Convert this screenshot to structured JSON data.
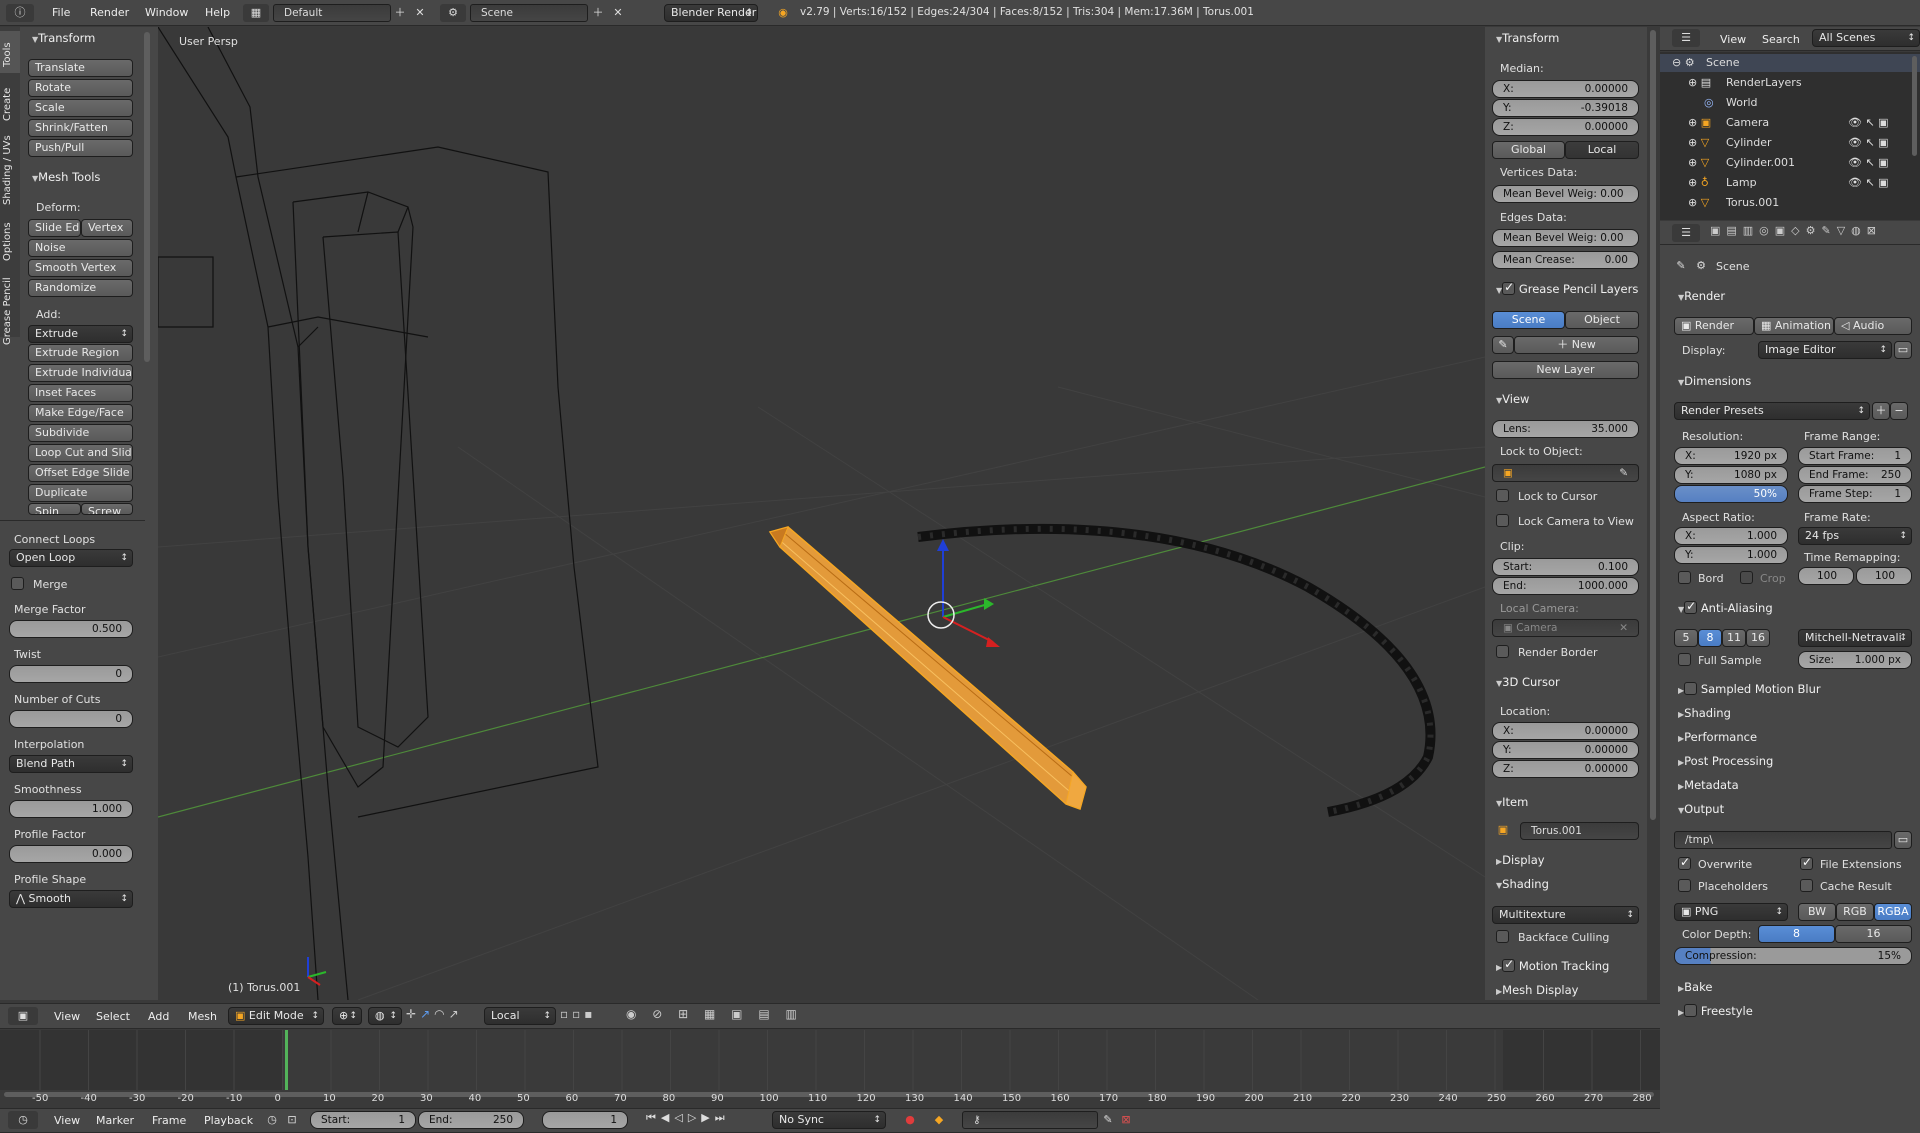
{
  "top_bar": {
    "menus": [
      "File",
      "Render",
      "Window",
      "Help"
    ],
    "screen_layout": "Default",
    "scene": "Scene",
    "engine": "Blender Render",
    "stats": "v2.79 | Verts:16/152 | Edges:24/304 | Faces:8/152 | Tris:304 | Mem:17.36M | Torus.001"
  },
  "tool_tabs": [
    "Tools",
    "Create",
    "Shading / UVs",
    "Options",
    "Grease Pencil"
  ],
  "tools": {
    "transform_title": "Transform",
    "transform_buttons": [
      "Translate",
      "Rotate",
      "Scale",
      "Shrink/Fatten",
      "Push/Pull"
    ],
    "mesh_tools_title": "Mesh Tools",
    "deform_label": "Deform:",
    "deform_row": [
      "Slide Ed",
      "Vertex"
    ],
    "deform_buttons": [
      "Noise",
      "Smooth Vertex",
      "Randomize"
    ],
    "add_label": "Add:",
    "extrude": "Extrude",
    "add_buttons": [
      "Extrude Region",
      "Extrude Individual",
      "Inset Faces",
      "Make Edge/Face",
      "Subdivide",
      "Loop Cut and Slide",
      "Offset Edge Slide",
      "Duplicate"
    ],
    "partial_row": [
      "Spin",
      "Screw"
    ]
  },
  "operator": {
    "title": "Connect Loops",
    "mode": "Open Loop",
    "merge_label": "Merge",
    "merge_factor_label": "Merge Factor",
    "merge_factor": "0.500",
    "twist_label": "Twist",
    "twist": "0",
    "cuts_label": "Number of Cuts",
    "cuts": "0",
    "interp_label": "Interpolation",
    "interp": "Blend Path",
    "smooth_label": "Smoothness",
    "smooth": "1.000",
    "profile_factor_label": "Profile Factor",
    "profile_factor": "0.000",
    "profile_shape_label": "Profile Shape",
    "profile_shape": "Smooth"
  },
  "viewport": {
    "view_name": "User Persp",
    "object_label": "(1) Torus.001"
  },
  "props": {
    "transform_title": "Transform",
    "median_label": "Median:",
    "x": "0.00000",
    "y": "-0.39018",
    "z": "0.00000",
    "global": "Global",
    "local": "Local",
    "vertices_data": "Vertices Data:",
    "mean_bevel_v": "Mean Bevel Weig: 0.00",
    "edges_data": "Edges Data:",
    "mean_bevel_e": "Mean Bevel Weig: 0.00",
    "mean_crease": "Mean Crease:",
    "mean_crease_val": "0.00",
    "gp_title": "Grease Pencil Layers",
    "gp_scene": "Scene",
    "gp_object": "Object",
    "gp_new": "New",
    "gp_new_layer": "New Layer",
    "view_title": "View",
    "lens_label": "Lens:",
    "lens": "35.000",
    "lock_obj": "Lock to Object:",
    "lock_cursor": "Lock to Cursor",
    "lock_camera": "Lock Camera to View",
    "clip": "Clip:",
    "clip_start_label": "Start:",
    "clip_start": "0.100",
    "clip_end_label": "End:",
    "clip_end": "1000.000",
    "local_camera": "Local Camera:",
    "camera": "Camera",
    "render_border": "Render Border",
    "cursor_title": "3D Cursor",
    "location": "Location:",
    "cx": "0.00000",
    "cy": "0.00000",
    "cz": "0.00000",
    "item_title": "Item",
    "item_name": "Torus.001",
    "display_title": "Display",
    "shading_title": "Shading",
    "shading_mode": "Multitexture",
    "backface": "Backface Culling",
    "motion_tracking": "Motion Tracking",
    "mesh_display": "Mesh Display"
  },
  "outliner": {
    "menus": [
      "View",
      "Search"
    ],
    "filter": "All Scenes",
    "items": [
      "Scene",
      "RenderLayers",
      "World",
      "Camera",
      "Cylinder",
      "Cylinder.001",
      "Lamp",
      "Torus.001"
    ]
  },
  "render": {
    "scene": "Scene",
    "render_title": "Render",
    "render_btn": "Render",
    "animation_btn": "Animation",
    "audio_btn": "Audio",
    "display_label": "Display:",
    "display": "Image Editor",
    "dimensions_title": "Dimensions",
    "presets": "Render Presets",
    "resolution": "Resolution:",
    "res_x": "1920 px",
    "res_y": "1080 px",
    "res_pct": "50%",
    "frame_range": "Frame Range:",
    "start_frame_label": "Start Frame:",
    "start_frame": "1",
    "end_frame_label": "End Frame:",
    "end_frame": "250",
    "frame_step_label": "Frame Step:",
    "frame_step": "1",
    "aspect": "Aspect Ratio:",
    "ax": "1.000",
    "ay": "1.000",
    "frame_rate": "Frame Rate:",
    "fps": "24 fps",
    "time_remap": "Time Remapping:",
    "remap_old": "100",
    "remap_new": "100",
    "bord": "Bord",
    "crop": "Crop",
    "aa_title": "Anti-Aliasing",
    "aa_samples": [
      "5",
      "8",
      "11",
      "16"
    ],
    "aa_filter": "Mitchell-Netravali",
    "full_sample": "Full Sample",
    "size_label": "Size:",
    "size": "1.000 px",
    "collapsed": [
      "Sampled Motion Blur",
      "Shading",
      "Performance",
      "Post Processing",
      "Metadata"
    ],
    "output_title": "Output",
    "path": "/tmp\\",
    "overwrite": "Overwrite",
    "file_ext": "File Extensions",
    "placeholders": "Placeholders",
    "cache": "Cache Result",
    "format": "PNG",
    "bw": "BW",
    "rgb": "RGB",
    "rgba": "RGBA",
    "color_depth": "Color Depth:",
    "depth8": "8",
    "depth16": "16",
    "compression_label": "Compression:",
    "compression": "15%",
    "bake": "Bake",
    "freestyle": "Freestyle"
  },
  "view_header": {
    "menus": [
      "View",
      "Select",
      "Add",
      "Mesh"
    ],
    "mode": "Edit Mode",
    "orientation": "Local"
  },
  "timeline": {
    "ticks": [
      "-50",
      "-40",
      "-30",
      "-20",
      "-10",
      "0",
      "10",
      "20",
      "30",
      "40",
      "50",
      "60",
      "70",
      "80",
      "90",
      "100",
      "110",
      "120",
      "130",
      "140",
      "150",
      "160",
      "170",
      "180",
      "190",
      "200",
      "210",
      "220",
      "230",
      "240",
      "250",
      "260",
      "270",
      "280"
    ],
    "menus": [
      "View",
      "Marker",
      "Frame",
      "Playback"
    ],
    "start_label": "Start:",
    "start": "1",
    "end_label": "End:",
    "end": "250",
    "current": "1",
    "sync": "No Sync"
  },
  "colors": {
    "accent": "#5680c2",
    "selected": "#f5a623",
    "background": "#3a3a3a",
    "panel": "#474747"
  }
}
